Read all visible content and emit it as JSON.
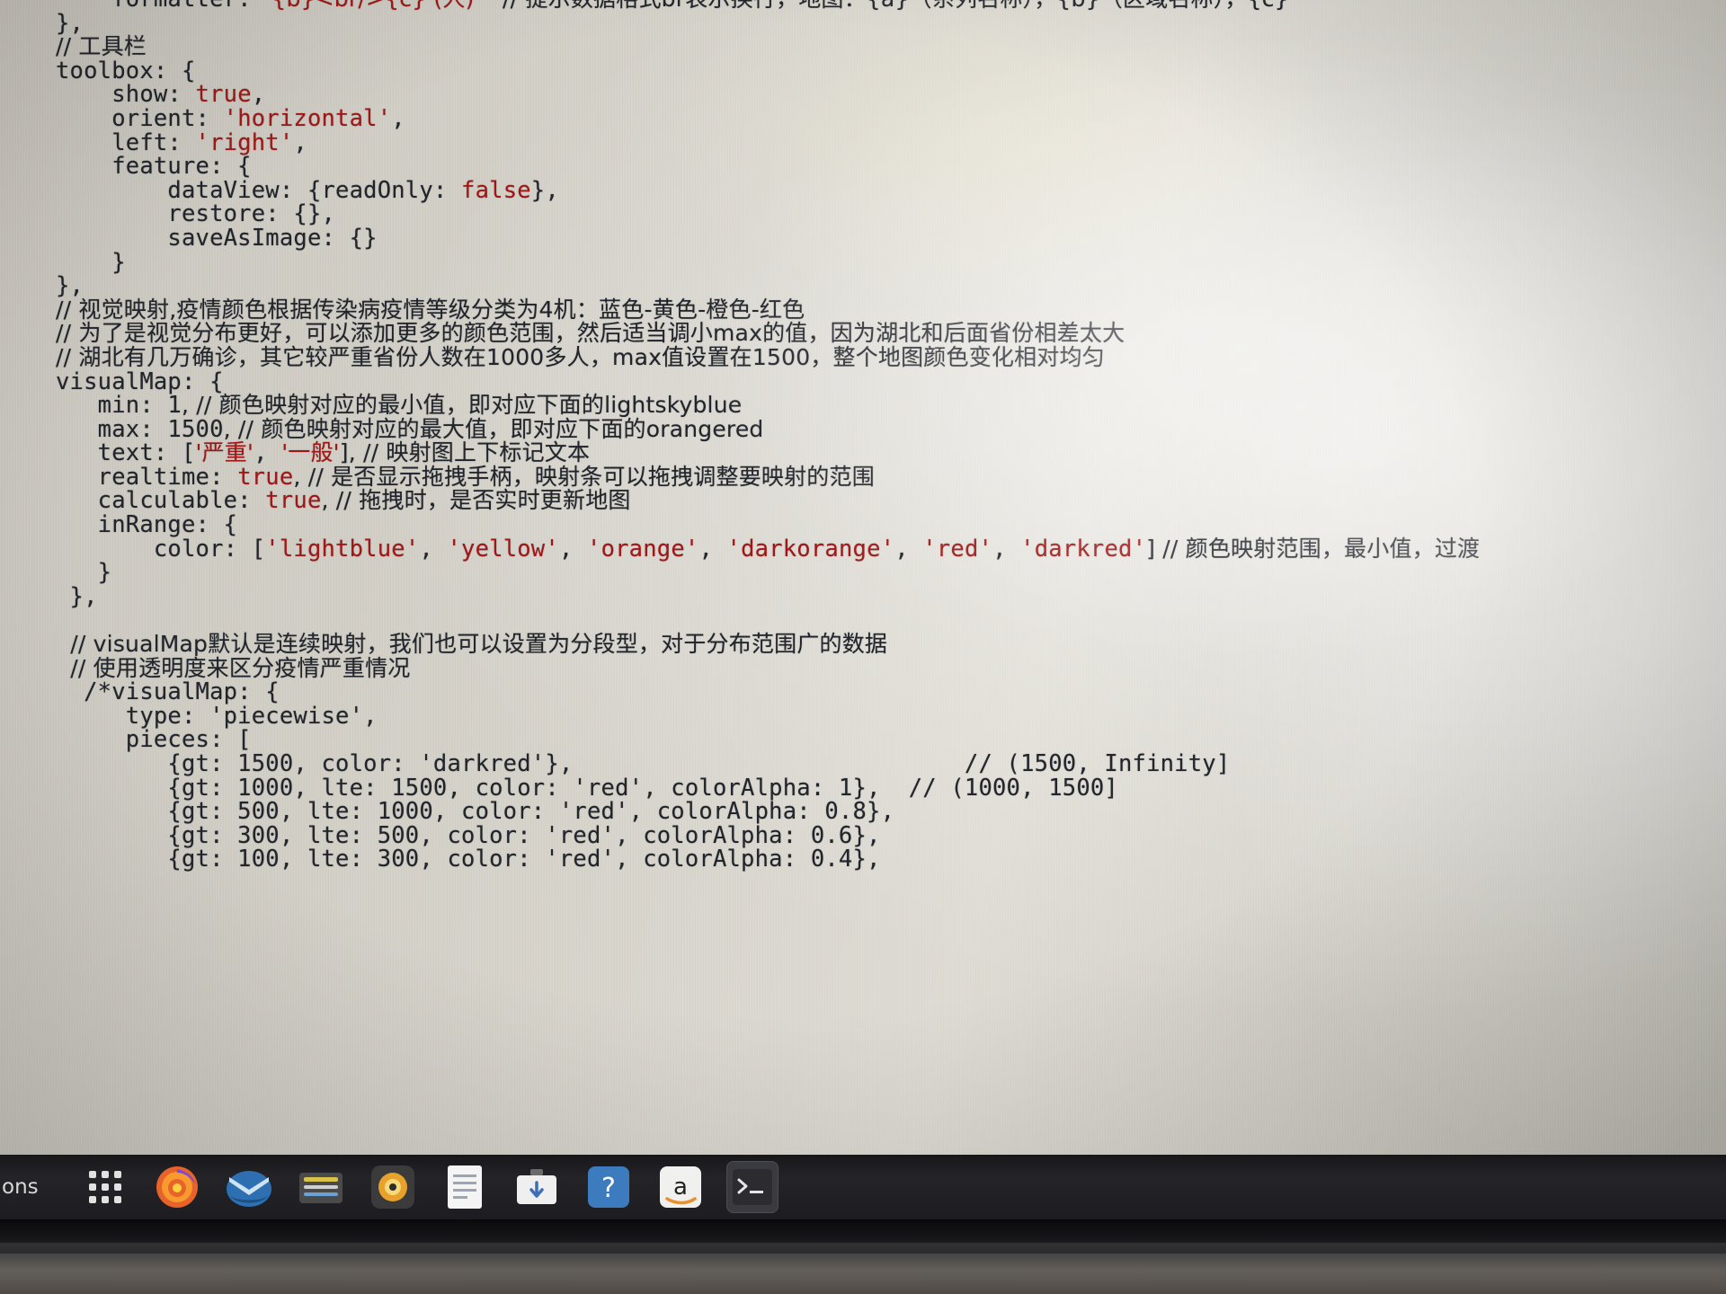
{
  "window": {
    "kind": "code-editor-photo",
    "description": "Photograph of a laptop screen showing an ECharts option object with Chinese comments"
  },
  "editor": {
    "language": "javascript",
    "colors": {
      "background": "#d6d3cb",
      "foreground": "#20242b",
      "string": "#a31515",
      "keyword_literal": "#a31515"
    },
    "lines": [
      {
        "indent": 0,
        "segments": [
          {
            "t": "    formatter: ",
            "c": "kw"
          },
          {
            "t": "'{b}<br/>{c} (人)'",
            "c": "str"
          },
          {
            "t": "   // 提示数据格式br表示换行，地图：{a}（系列名称），{b}（区域名称），{c}",
            "c": "cm"
          }
        ]
      },
      {
        "indent": 0,
        "segments": [
          {
            "t": "},",
            "c": "kw"
          }
        ]
      },
      {
        "indent": 0,
        "segments": [
          {
            "t": "// 工具栏",
            "c": "cm"
          }
        ]
      },
      {
        "indent": 0,
        "segments": [
          {
            "t": "toolbox: {",
            "c": "kw"
          }
        ]
      },
      {
        "indent": 1,
        "segments": [
          {
            "t": "    show: ",
            "c": "kw"
          },
          {
            "t": "true",
            "c": "lit"
          },
          {
            "t": ",",
            "c": "kw"
          }
        ]
      },
      {
        "indent": 1,
        "segments": [
          {
            "t": "    orient: ",
            "c": "kw"
          },
          {
            "t": "'horizontal'",
            "c": "str"
          },
          {
            "t": ",",
            "c": "kw"
          }
        ]
      },
      {
        "indent": 1,
        "segments": [
          {
            "t": "    left: ",
            "c": "kw"
          },
          {
            "t": "'right'",
            "c": "str"
          },
          {
            "t": ",",
            "c": "kw"
          }
        ]
      },
      {
        "indent": 1,
        "segments": [
          {
            "t": "    feature: {",
            "c": "kw"
          }
        ]
      },
      {
        "indent": 2,
        "segments": [
          {
            "t": "        dataView: {readOnly: ",
            "c": "kw"
          },
          {
            "t": "false",
            "c": "lit"
          },
          {
            "t": "},",
            "c": "kw"
          }
        ]
      },
      {
        "indent": 2,
        "segments": [
          {
            "t": "        restore: {},",
            "c": "kw"
          }
        ]
      },
      {
        "indent": 2,
        "segments": [
          {
            "t": "        saveAsImage: {}",
            "c": "kw"
          }
        ]
      },
      {
        "indent": 1,
        "segments": [
          {
            "t": "    }",
            "c": "kw"
          }
        ]
      },
      {
        "indent": 0,
        "segments": [
          {
            "t": "},",
            "c": "kw"
          }
        ]
      },
      {
        "indent": 0,
        "segments": [
          {
            "t": "// 视觉映射,疫情颜色根据传染病疫情等级分类为4机：蓝色-黄色-橙色-红色",
            "c": "cm"
          }
        ]
      },
      {
        "indent": 0,
        "segments": [
          {
            "t": "// 为了是视觉分布更好，可以添加更多的颜色范围，然后适当调小max的值，因为湖北和后面省份相差太大",
            "c": "cm"
          }
        ]
      },
      {
        "indent": 0,
        "segments": [
          {
            "t": "// 湖北有几万确诊，其它较严重省份人数在1000多人，max值设置在1500，整个地图颜色变化相对均匀",
            "c": "cm"
          }
        ]
      },
      {
        "indent": 0,
        "segments": [
          {
            "t": "visualMap: {",
            "c": "kw"
          }
        ]
      },
      {
        "indent": 1,
        "segments": [
          {
            "t": "   min: ",
            "c": "kw"
          },
          {
            "t": "1",
            "c": "num"
          },
          {
            "t": ", // 颜色映射对应的最小值，即对应下面的lightskyblue",
            "c": "cm"
          }
        ]
      },
      {
        "indent": 1,
        "segments": [
          {
            "t": "   max: ",
            "c": "kw"
          },
          {
            "t": "1500",
            "c": "num"
          },
          {
            "t": ", // 颜色映射对应的最大值，即对应下面的orangered",
            "c": "cm"
          }
        ]
      },
      {
        "indent": 1,
        "segments": [
          {
            "t": "   text: [",
            "c": "kw"
          },
          {
            "t": "'严重'",
            "c": "str"
          },
          {
            "t": ", ",
            "c": "kw"
          },
          {
            "t": "'一般'",
            "c": "str"
          },
          {
            "t": "], // 映射图上下标记文本",
            "c": "cm"
          }
        ]
      },
      {
        "indent": 1,
        "segments": [
          {
            "t": "   realtime: ",
            "c": "kw"
          },
          {
            "t": "true",
            "c": "lit"
          },
          {
            "t": ", // 是否显示拖拽手柄，映射条可以拖拽调整要映射的范围",
            "c": "cm"
          }
        ]
      },
      {
        "indent": 1,
        "segments": [
          {
            "t": "   calculable: ",
            "c": "kw"
          },
          {
            "t": "true",
            "c": "lit"
          },
          {
            "t": ", // 拖拽时，是否实时更新地图",
            "c": "cm"
          }
        ]
      },
      {
        "indent": 1,
        "segments": [
          {
            "t": "   inRange: {",
            "c": "kw"
          }
        ]
      },
      {
        "indent": 2,
        "segments": [
          {
            "t": "       color: [",
            "c": "kw"
          },
          {
            "t": "'lightblue'",
            "c": "str"
          },
          {
            "t": ", ",
            "c": "kw"
          },
          {
            "t": "'yellow'",
            "c": "str"
          },
          {
            "t": ", ",
            "c": "kw"
          },
          {
            "t": "'orange'",
            "c": "str"
          },
          {
            "t": ", ",
            "c": "kw"
          },
          {
            "t": "'darkorange'",
            "c": "str"
          },
          {
            "t": ", ",
            "c": "kw"
          },
          {
            "t": "'red'",
            "c": "str"
          },
          {
            "t": ", ",
            "c": "kw"
          },
          {
            "t": "'darkred'",
            "c": "str"
          },
          {
            "t": "] // 颜色映射范围，最小值，过渡",
            "c": "cm"
          }
        ]
      },
      {
        "indent": 1,
        "segments": [
          {
            "t": "   }",
            "c": "kw"
          }
        ]
      },
      {
        "indent": 0,
        "segments": [
          {
            "t": " },",
            "c": "kw"
          }
        ]
      },
      {
        "indent": 0,
        "segments": [
          {
            "t": "",
            "c": "kw"
          }
        ]
      },
      {
        "indent": 0,
        "segments": [
          {
            "t": "  // visualMap默认是连续映射，我们也可以设置为分段型，对于分布范围广的数据",
            "c": "cm"
          }
        ]
      },
      {
        "indent": 0,
        "segments": [
          {
            "t": "  // 使用透明度来区分疫情严重情况",
            "c": "cm"
          }
        ]
      },
      {
        "indent": 0,
        "segments": [
          {
            "t": "  /*visualMap: {",
            "c": "cm"
          }
        ]
      },
      {
        "indent": 1,
        "segments": [
          {
            "t": "     type: 'piecewise',",
            "c": "cm"
          }
        ]
      },
      {
        "indent": 1,
        "segments": [
          {
            "t": "     pieces: [",
            "c": "cm"
          }
        ]
      },
      {
        "indent": 2,
        "segments": [
          {
            "t": "        {gt: 1500, color: 'darkred'},                            // (1500, Infinity]",
            "c": "cm"
          }
        ]
      },
      {
        "indent": 2,
        "segments": [
          {
            "t": "        {gt: 1000, lte: 1500, color: 'red', colorAlpha: 1},  // (1000, 1500]",
            "c": "cm"
          }
        ]
      },
      {
        "indent": 2,
        "segments": [
          {
            "t": "        {gt: 500, lte: 1000, color: 'red', colorAlpha: 0.8},",
            "c": "cm"
          }
        ]
      },
      {
        "indent": 2,
        "segments": [
          {
            "t": "        {gt: 300, lte: 500, color: 'red', colorAlpha: 0.6},",
            "c": "cm"
          }
        ]
      },
      {
        "indent": 2,
        "segments": [
          {
            "t": "        {gt: 100, lte: 300, color: 'red', colorAlpha: 0.4},",
            "c": "cm"
          }
        ]
      }
    ]
  },
  "taskbar": {
    "left_label": "ons",
    "items": [
      {
        "name": "app-grid",
        "icon": "grid-icon",
        "label": "Show Applications",
        "active": false
      },
      {
        "name": "firefox",
        "icon": "firefox-icon",
        "label": "Firefox",
        "active": false
      },
      {
        "name": "thunderbird",
        "icon": "thunderbird-icon",
        "label": "Thunderbird Mail",
        "active": false
      },
      {
        "name": "files",
        "icon": "files-icon",
        "label": "Files",
        "active": false
      },
      {
        "name": "rhythmbox",
        "icon": "rhythmbox-icon",
        "label": "Rhythmbox",
        "active": false
      },
      {
        "name": "text-editor",
        "icon": "document-icon",
        "label": "LibreOffice Writer",
        "active": false
      },
      {
        "name": "software-center",
        "icon": "briefcase-icon",
        "label": "Ubuntu Software",
        "active": false
      },
      {
        "name": "help",
        "icon": "help-icon",
        "label": "Help",
        "active": false
      },
      {
        "name": "amazon",
        "icon": "amazon-icon",
        "label": "Amazon",
        "active": false
      },
      {
        "name": "terminal",
        "icon": "terminal-icon",
        "label": "Terminal",
        "active": true
      }
    ]
  }
}
